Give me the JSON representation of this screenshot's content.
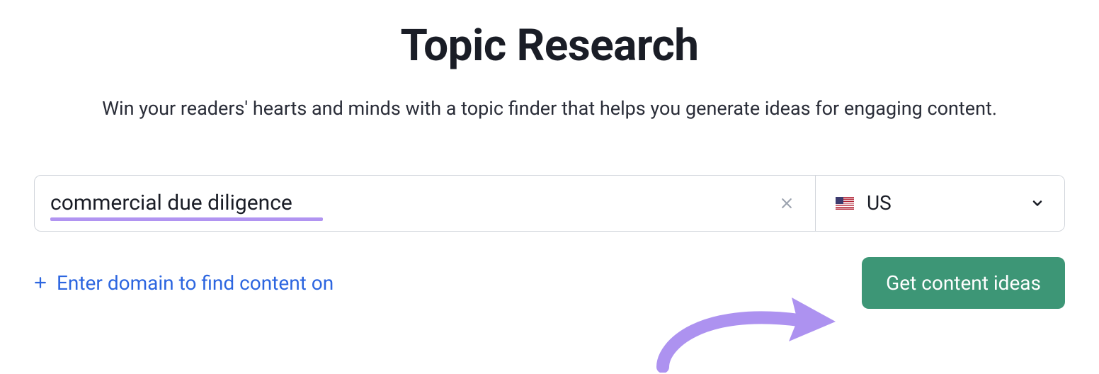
{
  "header": {
    "title": "Topic Research",
    "subtitle": "Win your readers' hearts and minds with a topic finder that helps you generate ideas for engaging content."
  },
  "search": {
    "topic_value": "commercial due diligence",
    "country_code": "US"
  },
  "actions": {
    "domain_link": "Enter domain to find content on",
    "cta_label": "Get content ideas"
  },
  "colors": {
    "accent_purple": "#b194f1",
    "cta_green": "#3d9676",
    "link_blue": "#2d66e0"
  }
}
